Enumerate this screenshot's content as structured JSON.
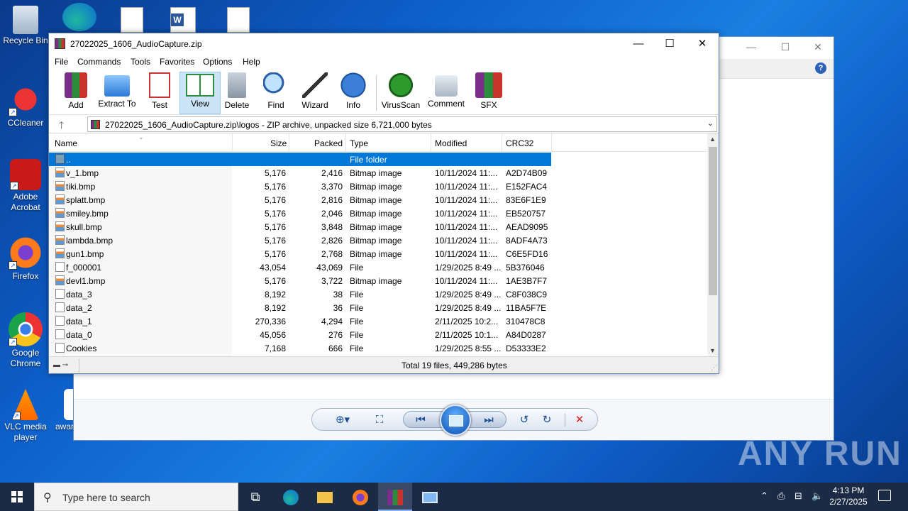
{
  "desktop": {
    "icons": [
      {
        "label": "Recycle Bin"
      },
      {
        "label": "CCleaner"
      },
      {
        "label": "Adobe Acrobat"
      },
      {
        "label": "Firefox"
      },
      {
        "label": "Google Chrome"
      },
      {
        "label": "VLC media player"
      },
      {
        "label": "awar"
      }
    ]
  },
  "winrar": {
    "title": "27022025_1606_AudioCapture.zip",
    "menu": [
      "File",
      "Commands",
      "Tools",
      "Favorites",
      "Options",
      "Help"
    ],
    "toolbar": [
      "Add",
      "Extract To",
      "Test",
      "View",
      "Delete",
      "Find",
      "Wizard",
      "Info",
      "VirusScan",
      "Comment",
      "SFX"
    ],
    "address": "27022025_1606_AudioCapture.zip\\logos - ZIP archive, unpacked size 6,721,000 bytes",
    "columns": [
      "Name",
      "Size",
      "Packed",
      "Type",
      "Modified",
      "CRC32"
    ],
    "rows": [
      {
        "name": "..",
        "size": "",
        "packed": "",
        "type": "File folder",
        "modified": "",
        "crc": ""
      },
      {
        "name": "v_1.bmp",
        "size": "5,176",
        "packed": "2,416",
        "type": "Bitmap image",
        "modified": "10/11/2024 11:...",
        "crc": "A2D74B09"
      },
      {
        "name": "tiki.bmp",
        "size": "5,176",
        "packed": "3,370",
        "type": "Bitmap image",
        "modified": "10/11/2024 11:...",
        "crc": "E152FAC4"
      },
      {
        "name": "splatt.bmp",
        "size": "5,176",
        "packed": "2,816",
        "type": "Bitmap image",
        "modified": "10/11/2024 11:...",
        "crc": "83E6F1E9"
      },
      {
        "name": "smiley.bmp",
        "size": "5,176",
        "packed": "2,046",
        "type": "Bitmap image",
        "modified": "10/11/2024 11:...",
        "crc": "EB520757"
      },
      {
        "name": "skull.bmp",
        "size": "5,176",
        "packed": "3,848",
        "type": "Bitmap image",
        "modified": "10/11/2024 11:...",
        "crc": "AEAD9095"
      },
      {
        "name": "lambda.bmp",
        "size": "5,176",
        "packed": "2,826",
        "type": "Bitmap image",
        "modified": "10/11/2024 11:...",
        "crc": "8ADF4A73"
      },
      {
        "name": "gun1.bmp",
        "size": "5,176",
        "packed": "2,768",
        "type": "Bitmap image",
        "modified": "10/11/2024 11:...",
        "crc": "C6E5FD16"
      },
      {
        "name": "f_000001",
        "size": "43,054",
        "packed": "43,069",
        "type": "File",
        "modified": "1/29/2025 8:49 ...",
        "crc": "5B376046"
      },
      {
        "name": "devl1.bmp",
        "size": "5,176",
        "packed": "3,722",
        "type": "Bitmap image",
        "modified": "10/11/2024 11:...",
        "crc": "1AE3B7F7"
      },
      {
        "name": "data_3",
        "size": "8,192",
        "packed": "38",
        "type": "File",
        "modified": "1/29/2025 8:49 ...",
        "crc": "C8F038C9"
      },
      {
        "name": "data_2",
        "size": "8,192",
        "packed": "36",
        "type": "File",
        "modified": "1/29/2025 8:49 ...",
        "crc": "11BA5F7E"
      },
      {
        "name": "data_1",
        "size": "270,336",
        "packed": "4,294",
        "type": "File",
        "modified": "2/11/2025 10:2...",
        "crc": "310478C8"
      },
      {
        "name": "data_0",
        "size": "45,056",
        "packed": "276",
        "type": "File",
        "modified": "2/11/2025 10:1...",
        "crc": "A84D0287"
      },
      {
        "name": "Cookies",
        "size": "7,168",
        "packed": "666",
        "type": "File",
        "modified": "1/29/2025 8:55 ...",
        "crc": "D53333E2"
      }
    ],
    "status_total": "Total 19 files, 449,286 bytes"
  },
  "taskbar": {
    "search_placeholder": "Type here to search",
    "time": "4:13 PM",
    "date": "2/27/2025"
  },
  "watermark": "ANY RUN"
}
